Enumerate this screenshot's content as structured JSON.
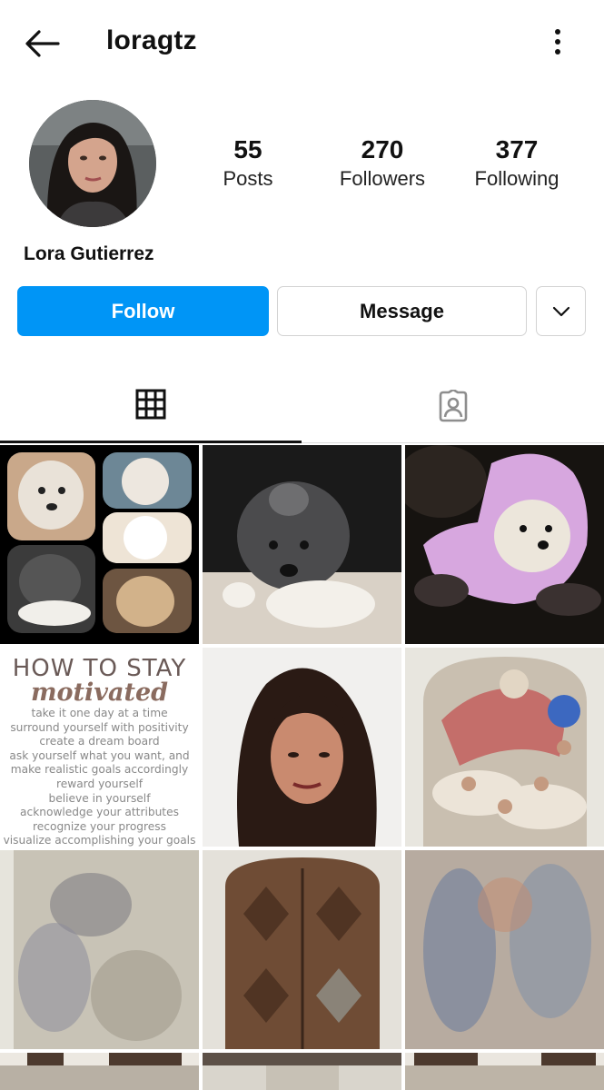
{
  "header": {
    "username": "loragtz"
  },
  "profile": {
    "full_name": "Lora Gutierrez",
    "stats": [
      {
        "value": "55",
        "label": "Posts"
      },
      {
        "value": "270",
        "label": "Followers"
      },
      {
        "value": "377",
        "label": "Following"
      }
    ]
  },
  "actions": {
    "follow_label": "Follow",
    "message_label": "Message"
  },
  "tabs": [
    {
      "icon": "grid-icon",
      "active": true
    },
    {
      "icon": "tagged-person-icon",
      "active": false
    }
  ],
  "colors": {
    "accent": "#0095f6"
  },
  "posts": {
    "motivation": {
      "title_1": "HOW TO STAY",
      "title_2": "motivated",
      "lines": [
        "take it one day at a time",
        "surround yourself with positivity",
        "create a dream board",
        "ask yourself what you want, and",
        "make realistic goals accordingly",
        "reward yourself",
        "believe in yourself",
        "acknowledge your attributes",
        "recognize your progress",
        "visualize accomplishing your goals"
      ]
    }
  }
}
